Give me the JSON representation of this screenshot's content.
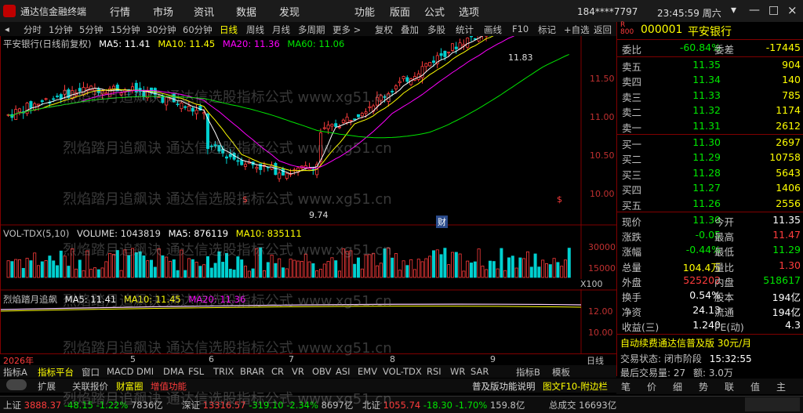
{
  "app": {
    "title": "通达信金融终端"
  },
  "menu": [
    "行情",
    "市场",
    "资讯",
    "数据",
    "发现",
    "功能",
    "版面",
    "公式",
    "选项"
  ],
  "account": {
    "user": "184****7797",
    "clock": "23:45:59 周六"
  },
  "toolbar": {
    "periods": [
      "分时",
      "1分钟",
      "5分钟",
      "15分钟",
      "30分钟",
      "60分钟",
      "日线",
      "周线",
      "月线",
      "多周期",
      "更多 >"
    ],
    "actions": [
      "复权",
      "叠加",
      "多股",
      "统计",
      "画线",
      "F10",
      "标记",
      "+自选",
      "返回"
    ],
    "active_period": "日线"
  },
  "chart": {
    "title_prefix": "平安银行(日线前复权)",
    "ma": {
      "ma5": "MA5: 11.41",
      "ma10": "MA10: 11.45",
      "ma20": "MA20: 11.36",
      "ma60": "MA60: 11.06"
    },
    "high_label": "11.83",
    "low_label": "9.74",
    "price_axis": [
      "11.50",
      "11.00",
      "10.50",
      "10.00"
    ],
    "markers": [
      "$",
      "$",
      "财"
    ],
    "vol_title": "VOL-TDX(5,10)",
    "vol_vals": {
      "volume": "VOLUME: 1043819",
      "ma5": "MA5: 876119",
      "ma10": "MA10: 835111"
    },
    "vol_axis": [
      "30000",
      "15000",
      "X100"
    ],
    "ind_title": "烈焰踏月追飙",
    "ind_vals": {
      "ma5": "MA5: 11.41",
      "ma10": "MA10: 11.45",
      "ma20": "MA20: 11.36",
      "note": "MA60: 11.06"
    },
    "ind_axis": [
      "12.00",
      "10.00"
    ],
    "x_axis": [
      "2026年",
      "5",
      "6",
      "7",
      "8",
      "9"
    ],
    "period_label": "日线"
  },
  "indicator_tabs": [
    "指标A",
    "指标平台",
    "窗口",
    "MACD",
    "DMI",
    "DMA",
    "FSL",
    "TRIX",
    "BRAR",
    "CR",
    "VR",
    "OBV",
    "ASI",
    "EMV",
    "VOL-TDX",
    "RSI",
    "WR",
    "SAR",
    "指标B",
    "模板"
  ],
  "status_tabs": [
    "扩展",
    "关联报价",
    "财富圈",
    "增值功能",
    "普及版功能说明",
    "图文F10-附边栏"
  ],
  "quote": {
    "code": "000001",
    "name": "平安银行",
    "weibi_label": "委比",
    "weibi": "-60.84%",
    "weicha_label": "委差",
    "weicha": "-17445",
    "sells": [
      {
        "label": "卖五",
        "price": "11.35",
        "vol": "904"
      },
      {
        "label": "卖四",
        "price": "11.34",
        "vol": "140"
      },
      {
        "label": "卖三",
        "price": "11.33",
        "vol": "785"
      },
      {
        "label": "卖二",
        "price": "11.32",
        "vol": "1174"
      },
      {
        "label": "卖一",
        "price": "11.31",
        "vol": "2612"
      }
    ],
    "buys": [
      {
        "label": "买一",
        "price": "11.30",
        "vol": "2697"
      },
      {
        "label": "买二",
        "price": "11.29",
        "vol": "10758"
      },
      {
        "label": "买三",
        "price": "11.28",
        "vol": "5643"
      },
      {
        "label": "买四",
        "price": "11.27",
        "vol": "1406"
      },
      {
        "label": "买五",
        "price": "11.26",
        "vol": "2556"
      }
    ],
    "stats": [
      {
        "l1": "现价",
        "v1": "11.30",
        "c1": "green",
        "l2": "今开",
        "v2": "11.35",
        "c2": "white"
      },
      {
        "l1": "涨跌",
        "v1": "-0.05",
        "c1": "green",
        "l2": "最高",
        "v2": "11.47",
        "c2": "red"
      },
      {
        "l1": "涨幅",
        "v1": "-0.44%",
        "c1": "green",
        "l2": "最低",
        "v2": "11.29",
        "c2": "green"
      },
      {
        "l1": "总量",
        "v1": "104.4万",
        "c1": "yellow",
        "l2": "量比",
        "v2": "1.30",
        "c2": "red"
      },
      {
        "l1": "外盘",
        "v1": "525202",
        "c1": "red",
        "l2": "内盘",
        "v2": "518617",
        "c2": "green"
      },
      {
        "l1": "换手",
        "v1": "0.54%",
        "c1": "white",
        "l2": "股本",
        "v2": "194亿",
        "c2": "white"
      },
      {
        "l1": "净资",
        "v1": "24.13",
        "c1": "white",
        "l2": "流通",
        "v2": "194亿",
        "c2": "white"
      },
      {
        "l1": "收益(三)",
        "v1": "1.240",
        "c1": "white",
        "l2": "PE(动)",
        "v2": "4.3",
        "c2": "white"
      }
    ],
    "promo": "自动续费通达信普及版 30元/月",
    "trade_status": "交易状态: 闭市阶段",
    "trade_time": "15:32:55",
    "last_trade": "最后交易量: 27",
    "amount": "额: 3.0万",
    "side_tabs": [
      "笔",
      "价",
      "细",
      "势",
      "联",
      "值",
      "主"
    ]
  },
  "market": [
    {
      "name": "上证",
      "value": "3888.37",
      "change": "-48.15",
      "pct": "-1.22%",
      "amount": "7836亿"
    },
    {
      "name": "深证",
      "value": "13316.57",
      "change": "-319.10",
      "pct": "-2.34%",
      "amount": "8697亿"
    },
    {
      "name": "北证",
      "value": "1055.74",
      "change": "-18.30",
      "pct": "-1.70%",
      "amount": "159.8亿"
    }
  ],
  "footer": {
    "total_label": "总成交",
    "total": "16693亿"
  },
  "watermark": {
    "text1": "烈焰踏月追飙诀",
    "text2": "通达信选股指标公式",
    "text3": "www.xg51.cn"
  }
}
